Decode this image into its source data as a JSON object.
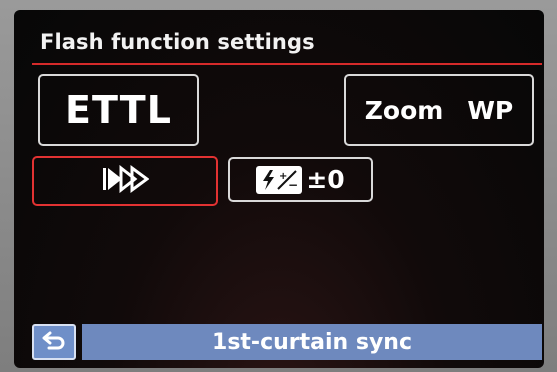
{
  "screen": {
    "title": "Flash function settings",
    "accent_color": "#d52a2a"
  },
  "settings": {
    "flash_mode": {
      "label": "ETTL"
    },
    "zoom": {
      "label": "Zoom",
      "value": "WP"
    },
    "sync_mode": {
      "icon": "high-speed-sync-icon",
      "selected": true
    },
    "flash_exposure_comp": {
      "icon": "flash-exposure-compensation-icon",
      "value": "±0"
    }
  },
  "bottom_bar": {
    "back_icon": "return-arrow-icon",
    "status_text": "1st-curtain sync",
    "bar_color": "#6e89be"
  }
}
